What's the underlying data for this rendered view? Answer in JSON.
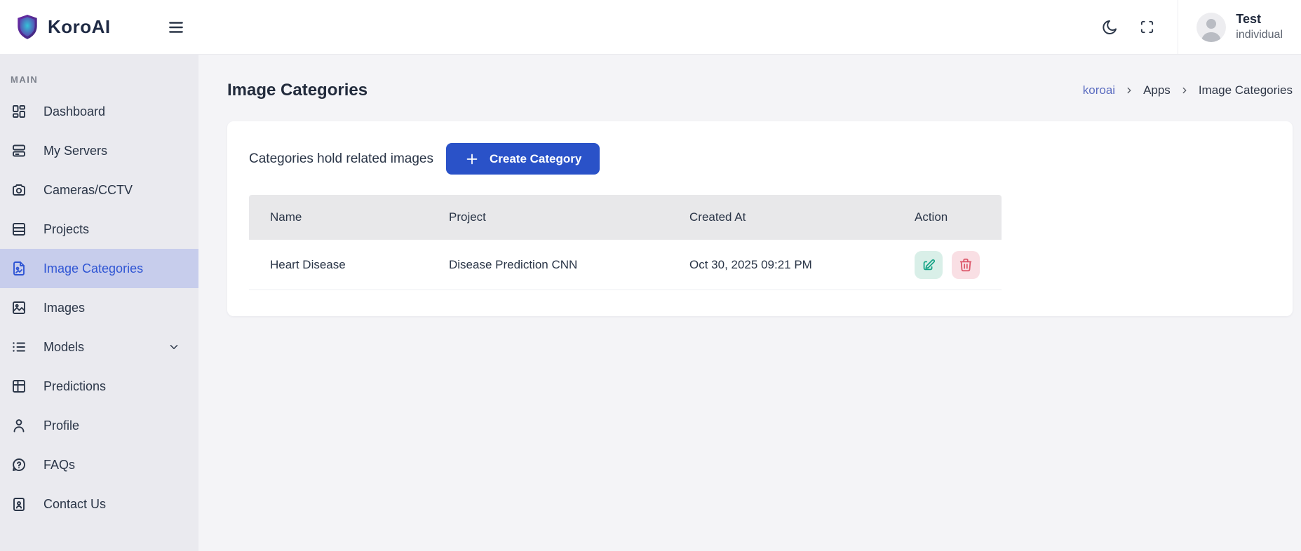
{
  "header": {
    "brand": "KoroAI",
    "user": {
      "name": "Test",
      "role": "individual"
    }
  },
  "sidebar": {
    "section_label": "MAIN",
    "items": [
      {
        "label": "Dashboard"
      },
      {
        "label": "My Servers"
      },
      {
        "label": "Cameras/CCTV"
      },
      {
        "label": "Projects"
      },
      {
        "label": "Image Categories",
        "active": true
      },
      {
        "label": "Images"
      },
      {
        "label": "Models",
        "expandable": true
      },
      {
        "label": "Predictions"
      },
      {
        "label": "Profile"
      },
      {
        "label": "FAQs"
      },
      {
        "label": "Contact Us"
      }
    ]
  },
  "page": {
    "title": "Image Categories",
    "breadcrumb": [
      "koroai",
      "Apps",
      "Image Categories"
    ]
  },
  "card": {
    "subtitle": "Categories hold related images",
    "create_button": "Create Category"
  },
  "table": {
    "columns": [
      "Name",
      "Project",
      "Created At",
      "Action"
    ],
    "rows": [
      {
        "name": "Heart Disease",
        "project": "Disease Prediction CNN",
        "created_at": "Oct 30, 2025 09:21 PM"
      }
    ]
  },
  "icons": {
    "brand": "shield-logo",
    "header": [
      "hamburger-menu",
      "moon-dark-mode",
      "fullscreen-maximize",
      "user-avatar"
    ],
    "sidebar": [
      "dashboard-grid",
      "servers",
      "camera",
      "projects-table",
      "image-file",
      "photo",
      "models-list",
      "predictions-columns",
      "person",
      "question-bubble",
      "id-card",
      "chevron-down"
    ],
    "row_actions": [
      "edit-pencil-square",
      "trash"
    ]
  },
  "colors": {
    "primary_button": "#2a52c8",
    "sidebar_bg": "#eaeaef",
    "active_item_bg": "#c7cdec",
    "active_item_text": "#2f55d4",
    "breadcrumb_link": "#5b6cc0",
    "table_header_bg": "#e8e8ea",
    "edit_icon": "#14a385",
    "edit_bg": "#d9efe8",
    "delete_icon": "#dc5568",
    "delete_bg": "#f9dfe4",
    "text_dark": "#2a3547"
  }
}
